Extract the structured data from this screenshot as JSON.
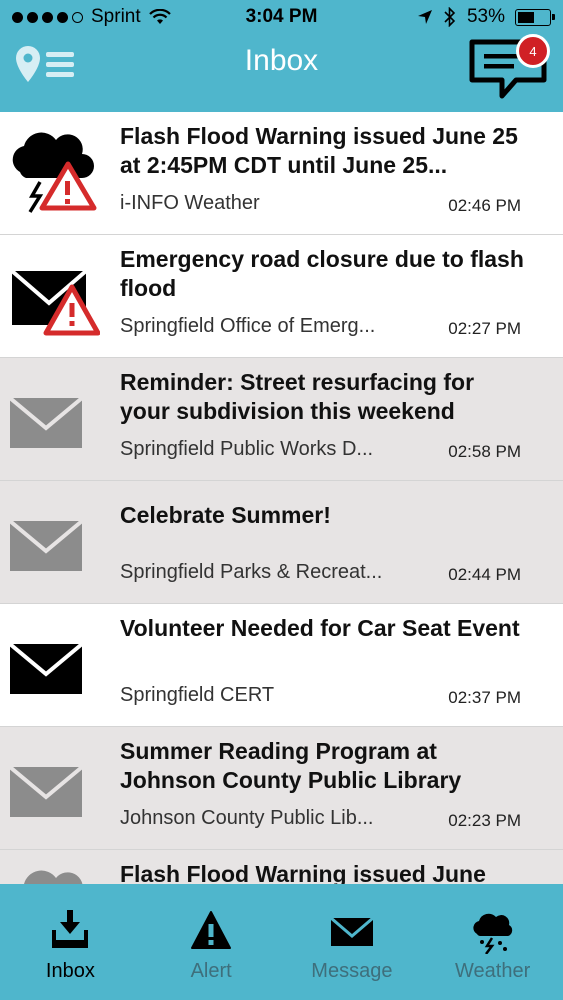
{
  "status_bar": {
    "carrier": "Sprint",
    "time": "3:04 PM",
    "battery": "53%"
  },
  "header": {
    "title": "Inbox",
    "badge_count": "4"
  },
  "messages": [
    {
      "title": "Flash Flood Warning issued June 25 at 2:45PM CDT until June 25...",
      "sender": "i-INFO Weather",
      "time": "02:46 PM",
      "icon": "storm-alert-icon",
      "read": false
    },
    {
      "title": "Emergency road closure due to flash flood",
      "sender": "Springfield Office of Emerg...",
      "time": "02:27 PM",
      "icon": "envelope-alert-icon",
      "read": false
    },
    {
      "title": "Reminder: Street resurfacing for your subdivision this weekend",
      "sender": "Springfield Public Works D...",
      "time": "02:58 PM",
      "icon": "envelope-icon",
      "read": true
    },
    {
      "title": "Celebrate Summer!",
      "sender": "Springfield Parks & Recreat...",
      "time": "02:44 PM",
      "icon": "envelope-icon",
      "read": true
    },
    {
      "title": "Volunteer Needed for Car Seat Event",
      "sender": "Springfield CERT",
      "time": "02:37 PM",
      "icon": "envelope-icon",
      "read": false
    },
    {
      "title": "Summer Reading Program at Johnson County Public Library",
      "sender": "Johnson County Public Lib...",
      "time": "02:23 PM",
      "icon": "envelope-icon",
      "read": true
    },
    {
      "title": "Flash Flood Warning issued June",
      "sender": "",
      "time": "",
      "icon": "storm-alert-icon",
      "read": true
    }
  ],
  "tabs": [
    {
      "label": "Inbox",
      "icon": "inbox-download-icon",
      "active": true
    },
    {
      "label": "Alert",
      "icon": "warning-triangle-icon",
      "active": false
    },
    {
      "label": "Message",
      "icon": "envelope-icon",
      "active": false
    },
    {
      "label": "Weather",
      "icon": "storm-cloud-icon",
      "active": false
    }
  ],
  "colors": {
    "accent": "#4fb6cc",
    "badge": "#d02025",
    "unread_row": "#ffffff",
    "read_row": "#e7e4e4"
  }
}
